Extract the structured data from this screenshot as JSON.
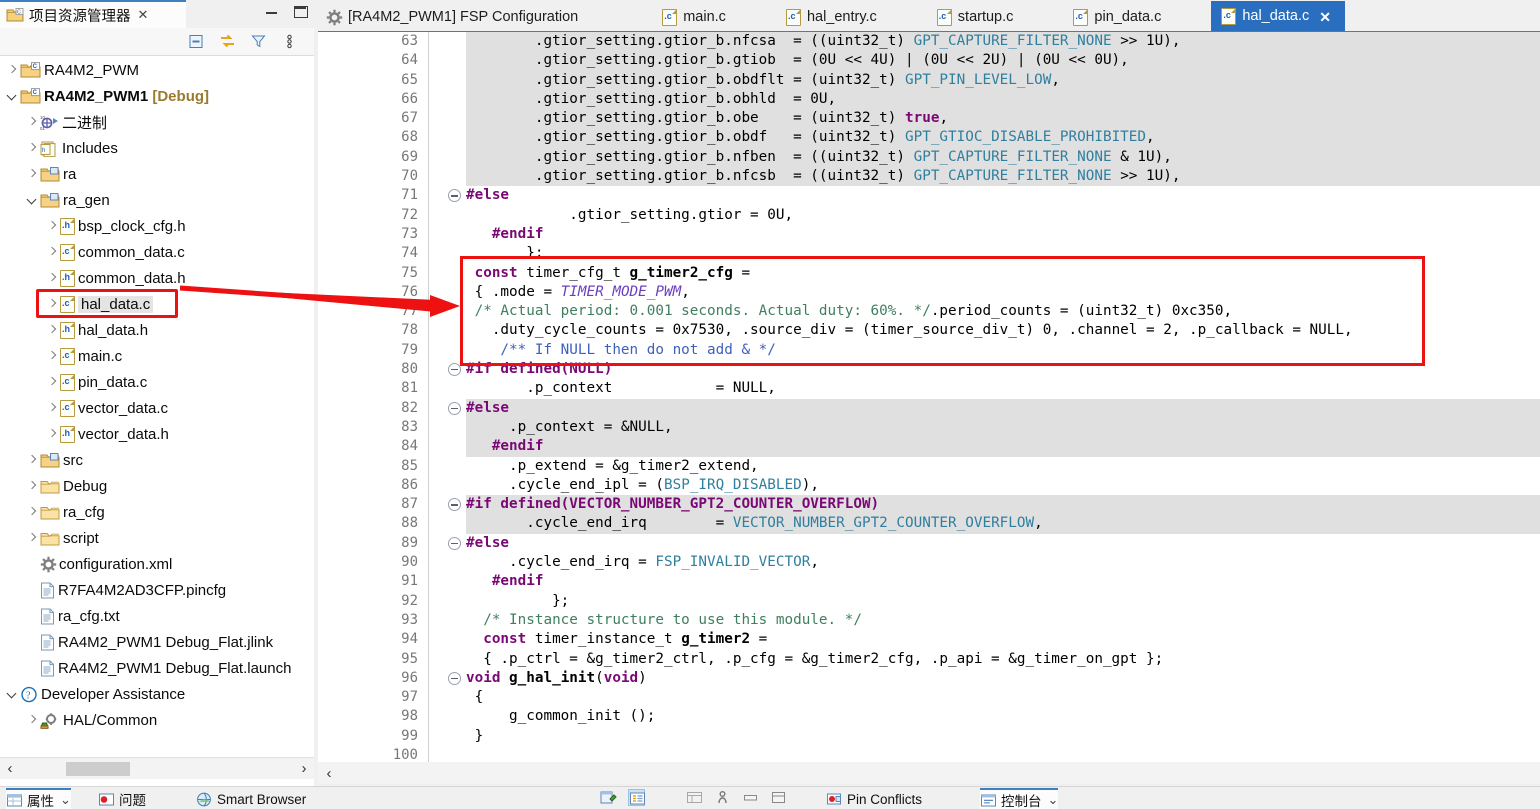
{
  "window": {
    "accent": "#2a6ebf",
    "highlight_red": "#ee1111",
    "row_highlight": "#e0e0e0"
  },
  "editor_tabs": [
    {
      "label": "[RA4M2_PWM1] FSP Configuration",
      "icon": "gear-icon",
      "active": false,
      "closable": false
    },
    {
      "label": "main.c",
      "icon": "c-file-icon",
      "active": false,
      "closable": false
    },
    {
      "label": "hal_entry.c",
      "icon": "c-file-icon",
      "active": false,
      "closable": false
    },
    {
      "label": "startup.c",
      "icon": "c-file-icon",
      "active": false,
      "closable": false
    },
    {
      "label": "pin_data.c",
      "icon": "c-file-icon",
      "active": false,
      "closable": false
    },
    {
      "label": "hal_data.c",
      "icon": "c-file-icon",
      "active": true,
      "closable": true,
      "close_label": "✕"
    }
  ],
  "project_explorer": {
    "title": "项目资源管理器",
    "tab_close_label": "✕",
    "minimize_label": "minimize",
    "maximize_label": "maximize",
    "toolbar_icons": [
      {
        "name": "collapse-all-icon",
        "tooltip": "Collapse All"
      },
      {
        "name": "link-with-editor-icon",
        "tooltip": "Link with Editor"
      },
      {
        "name": "filter-icon",
        "tooltip": "Filters"
      },
      {
        "name": "view-menu-icon",
        "tooltip": "View Menu"
      }
    ],
    "tree": [
      {
        "label": "RA4M2_PWM",
        "indent": 0,
        "state": "closed",
        "icon": "c-project-folder-icon",
        "bold": false
      },
      {
        "label": "RA4M2_PWM1",
        "suffix": "[Debug]",
        "indent": 0,
        "state": "open",
        "icon": "c-project-folder-icon",
        "bold": true
      },
      {
        "label": "二进制",
        "indent": 1,
        "state": "closed",
        "icon": "binaries-icon",
        "bold": false
      },
      {
        "label": "Includes",
        "indent": 1,
        "state": "closed",
        "icon": "includes-icon",
        "bold": false
      },
      {
        "label": "ra",
        "indent": 1,
        "state": "closed",
        "icon": "source-folder-icon",
        "bold": false
      },
      {
        "label": "ra_gen",
        "indent": 1,
        "state": "open",
        "icon": "source-folder-icon",
        "bold": false
      },
      {
        "label": "bsp_clock_cfg.h",
        "indent": 2,
        "state": "closed",
        "icon": "h-file-icon",
        "bold": false
      },
      {
        "label": "common_data.c",
        "indent": 2,
        "state": "closed",
        "icon": "c-file-icon",
        "bold": false
      },
      {
        "label": "common_data.h",
        "indent": 2,
        "state": "closed",
        "icon": "h-file-icon",
        "bold": false
      },
      {
        "label": "hal_data.c",
        "indent": 2,
        "state": "closed",
        "icon": "c-file-icon",
        "bold": false,
        "selected": true
      },
      {
        "label": "hal_data.h",
        "indent": 2,
        "state": "closed",
        "icon": "h-file-icon",
        "bold": false
      },
      {
        "label": "main.c",
        "indent": 2,
        "state": "closed",
        "icon": "c-file-icon",
        "bold": false
      },
      {
        "label": "pin_data.c",
        "indent": 2,
        "state": "closed",
        "icon": "c-file-icon",
        "bold": false
      },
      {
        "label": "vector_data.c",
        "indent": 2,
        "state": "closed",
        "icon": "c-file-icon",
        "bold": false
      },
      {
        "label": "vector_data.h",
        "indent": 2,
        "state": "closed",
        "icon": "h-file-icon",
        "bold": false
      },
      {
        "label": "src",
        "indent": 1,
        "state": "closed",
        "icon": "source-folder-icon",
        "bold": false
      },
      {
        "label": "Debug",
        "indent": 1,
        "state": "closed",
        "icon": "folder-icon",
        "bold": false
      },
      {
        "label": "ra_cfg",
        "indent": 1,
        "state": "closed",
        "icon": "folder-icon",
        "bold": false
      },
      {
        "label": "script",
        "indent": 1,
        "state": "closed",
        "icon": "folder-icon",
        "bold": false
      },
      {
        "label": "configuration.xml",
        "indent": 1,
        "state": "none",
        "icon": "gear-icon",
        "bold": false
      },
      {
        "label": "R7FA4M2AD3CFP.pincfg",
        "indent": 1,
        "state": "none",
        "icon": "document-icon",
        "bold": false
      },
      {
        "label": "ra_cfg.txt",
        "indent": 1,
        "state": "none",
        "icon": "document-icon",
        "bold": false
      },
      {
        "label": "RA4M2_PWM1 Debug_Flat.jlink",
        "indent": 1,
        "state": "none",
        "icon": "document-icon",
        "bold": false
      },
      {
        "label": "RA4M2_PWM1 Debug_Flat.launch",
        "indent": 1,
        "state": "none",
        "icon": "document-icon",
        "bold": false
      },
      {
        "label": "Developer Assistance",
        "indent": 0,
        "state": "open",
        "icon": "help-icon",
        "bold": false
      },
      {
        "label": "HAL/Common",
        "indent": 1,
        "state": "closed",
        "icon": "hal-module-icon",
        "bold": false
      }
    ],
    "hscroll": {
      "left_arrow": "‹",
      "right_arrow": "›"
    }
  },
  "code": {
    "first_line": 63,
    "last_line": 100,
    "hscroll_left_arrow": "‹",
    "lines": [
      {
        "n": 63,
        "hl": true,
        "fold": false,
        "segs": [
          [
            "",
            "        .gtior_setting.gtior_b.nfcsa  = (("
          ],
          [
            "ty",
            "uint32_t"
          ],
          [
            "",
            ") "
          ],
          [
            "mac",
            "GPT_CAPTURE_FILTER_NONE"
          ],
          [
            "",
            " >> 1U),"
          ]
        ]
      },
      {
        "n": 64,
        "hl": true,
        "fold": false,
        "segs": [
          [
            "",
            "        .gtior_setting.gtior_b.gtiob  = (0U << 4U) | (0U << 2U) | (0U << 0U),"
          ]
        ]
      },
      {
        "n": 65,
        "hl": true,
        "fold": false,
        "segs": [
          [
            "",
            "        .gtior_setting.gtior_b.obdflt = ("
          ],
          [
            "ty",
            "uint32_t"
          ],
          [
            "",
            ") "
          ],
          [
            "mac",
            "GPT_PIN_LEVEL_LOW"
          ],
          [
            "",
            ","
          ]
        ]
      },
      {
        "n": 66,
        "hl": true,
        "fold": false,
        "segs": [
          [
            "",
            "        .gtior_setting.gtior_b.obhld  = 0U,"
          ]
        ]
      },
      {
        "n": 67,
        "hl": true,
        "fold": false,
        "segs": [
          [
            "",
            "        .gtior_setting.gtior_b.obe    = ("
          ],
          [
            "ty",
            "uint32_t"
          ],
          [
            "",
            ") "
          ],
          [
            "k",
            "true"
          ],
          [
            "",
            ","
          ]
        ]
      },
      {
        "n": 68,
        "hl": true,
        "fold": false,
        "segs": [
          [
            "",
            "        .gtior_setting.gtior_b.obdf   = ("
          ],
          [
            "ty",
            "uint32_t"
          ],
          [
            "",
            ") "
          ],
          [
            "mac",
            "GPT_GTIOC_DISABLE_PROHIBITED"
          ],
          [
            "",
            ","
          ]
        ]
      },
      {
        "n": 69,
        "hl": true,
        "fold": false,
        "segs": [
          [
            "",
            "        .gtior_setting.gtior_b.nfben  = (("
          ],
          [
            "ty",
            "uint32_t"
          ],
          [
            "",
            ") "
          ],
          [
            "mac",
            "GPT_CAPTURE_FILTER_NONE"
          ],
          [
            "",
            " & 1U),"
          ]
        ]
      },
      {
        "n": 70,
        "hl": true,
        "fold": false,
        "segs": [
          [
            "",
            "        .gtior_setting.gtior_b.nfcsb  = (("
          ],
          [
            "ty",
            "uint32_t"
          ],
          [
            "",
            ") "
          ],
          [
            "mac",
            "GPT_CAPTURE_FILTER_NONE"
          ],
          [
            "",
            " >> 1U),"
          ]
        ]
      },
      {
        "n": 71,
        "hl": false,
        "fold": true,
        "segs": [
          [
            "pp",
            "#else"
          ]
        ]
      },
      {
        "n": 72,
        "hl": false,
        "fold": false,
        "segs": [
          [
            "",
            "            .gtior_setting.gtior = 0U,"
          ]
        ]
      },
      {
        "n": 73,
        "hl": false,
        "fold": false,
        "segs": [
          [
            "pp",
            "   #endif"
          ]
        ]
      },
      {
        "n": 74,
        "hl": false,
        "fold": false,
        "segs": [
          [
            "",
            "       };"
          ]
        ]
      },
      {
        "n": 75,
        "hl": false,
        "fold": false,
        "segs": [
          [
            "k",
            " const "
          ],
          [
            "ty",
            "timer_cfg_t"
          ],
          [
            "fn",
            " g_timer2_cfg"
          ],
          [
            "",
            " ="
          ]
        ]
      },
      {
        "n": 76,
        "hl": false,
        "fold": false,
        "segs": [
          [
            "",
            " { .mode = "
          ],
          [
            "ital",
            "TIMER_MODE_PWM"
          ],
          [
            "",
            ","
          ]
        ]
      },
      {
        "n": 77,
        "hl": false,
        "fold": false,
        "segs": [
          [
            "cm",
            " /* Actual period: 0.001 seconds. Actual duty: 60%. */"
          ],
          [
            "",
            ".period_counts = ("
          ],
          [
            "ty",
            "uint32_t"
          ],
          [
            "",
            ") 0xc350,"
          ]
        ]
      },
      {
        "n": 78,
        "hl": false,
        "fold": false,
        "segs": [
          [
            "",
            "   .duty_cycle_counts = 0x7530, .source_div = ("
          ],
          [
            "ty",
            "timer_source_div_t"
          ],
          [
            "",
            ") 0, .channel = 2, .p_callback = NULL,"
          ]
        ]
      },
      {
        "n": 79,
        "hl": false,
        "fold": false,
        "segs": [
          [
            "cmb",
            "    /** If NULL then do not add & */"
          ]
        ]
      },
      {
        "n": 80,
        "hl": false,
        "fold": true,
        "segs": [
          [
            "pp",
            "#if defined(NULL)"
          ]
        ]
      },
      {
        "n": 81,
        "hl": false,
        "fold": false,
        "segs": [
          [
            "",
            "       .p_context            = NULL,"
          ]
        ]
      },
      {
        "n": 82,
        "hl": true,
        "fold": true,
        "segs": [
          [
            "pp",
            "#else"
          ]
        ]
      },
      {
        "n": 83,
        "hl": true,
        "fold": false,
        "segs": [
          [
            "",
            "     .p_context = &NULL,"
          ]
        ]
      },
      {
        "n": 84,
        "hl": true,
        "fold": false,
        "segs": [
          [
            "pp",
            "   #endif"
          ]
        ]
      },
      {
        "n": 85,
        "hl": false,
        "fold": false,
        "segs": [
          [
            "",
            "     .p_extend = &g_timer2_extend,"
          ]
        ]
      },
      {
        "n": 86,
        "hl": false,
        "fold": false,
        "segs": [
          [
            "",
            "     .cycle_end_ipl = ("
          ],
          [
            "mac",
            "BSP_IRQ_DISABLED"
          ],
          [
            "",
            "),"
          ]
        ]
      },
      {
        "n": 87,
        "hl": true,
        "fold": true,
        "segs": [
          [
            "pp",
            "#if defined(VECTOR_NUMBER_GPT2_COUNTER_OVERFLOW)"
          ]
        ]
      },
      {
        "n": 88,
        "hl": true,
        "fold": false,
        "segs": [
          [
            "",
            "       .cycle_end_irq        = "
          ],
          [
            "mac",
            "VECTOR_NUMBER_GPT2_COUNTER_OVERFLOW"
          ],
          [
            "",
            ","
          ]
        ]
      },
      {
        "n": 89,
        "hl": false,
        "fold": true,
        "segs": [
          [
            "pp",
            "#else"
          ]
        ]
      },
      {
        "n": 90,
        "hl": false,
        "fold": false,
        "segs": [
          [
            "",
            "     .cycle_end_irq = "
          ],
          [
            "mac",
            "FSP_INVALID_VECTOR"
          ],
          [
            "",
            ","
          ]
        ]
      },
      {
        "n": 91,
        "hl": false,
        "fold": false,
        "segs": [
          [
            "pp",
            "   #endif"
          ]
        ]
      },
      {
        "n": 92,
        "hl": false,
        "fold": false,
        "segs": [
          [
            "",
            "          };"
          ]
        ]
      },
      {
        "n": 93,
        "hl": false,
        "fold": false,
        "segs": [
          [
            "cm",
            "  /* Instance structure to use this module. */"
          ]
        ]
      },
      {
        "n": 94,
        "hl": false,
        "fold": false,
        "segs": [
          [
            "k",
            "  const "
          ],
          [
            "ty",
            "timer_instance_t"
          ],
          [
            "fn",
            " g_timer2"
          ],
          [
            "",
            " ="
          ]
        ]
      },
      {
        "n": 95,
        "hl": false,
        "fold": false,
        "segs": [
          [
            "",
            "  { .p_ctrl = &g_timer2_ctrl, .p_cfg = &g_timer2_cfg, .p_api = &g_timer_on_gpt };"
          ]
        ]
      },
      {
        "n": 96,
        "hl": false,
        "fold": true,
        "segs": [
          [
            "k",
            "void"
          ],
          [
            "fn",
            " g_hal_init"
          ],
          [
            "",
            "("
          ],
          [
            "k",
            "void"
          ],
          [
            "",
            ")"
          ]
        ]
      },
      {
        "n": 97,
        "hl": false,
        "fold": false,
        "segs": [
          [
            "",
            " {"
          ]
        ]
      },
      {
        "n": 98,
        "hl": false,
        "fold": false,
        "segs": [
          [
            "",
            "     g_common_init ();"
          ]
        ]
      },
      {
        "n": 99,
        "hl": false,
        "fold": false,
        "segs": [
          [
            "",
            " }"
          ]
        ]
      },
      {
        "n": 100,
        "hl": false,
        "fold": false,
        "segs": [
          [
            "",
            ""
          ]
        ]
      }
    ]
  },
  "annotations": {
    "tree_box_target": "hal_data.c",
    "code_box_target": "g_timer2_cfg definition",
    "arrow_color": "#ee1111"
  },
  "bottom_bar": {
    "tabs": [
      {
        "label": "属性",
        "icon": "properties-icon",
        "selected": true,
        "pin": "⌄"
      },
      {
        "label": "问题",
        "icon": "problems-icon",
        "selected": false
      },
      {
        "label": "Smart Browser",
        "icon": "smart-browser-icon",
        "selected": false
      },
      {
        "label": "Pin Conflicts",
        "icon": "pin-conflicts-icon",
        "selected": false
      },
      {
        "label": "控制台",
        "icon": "console-icon",
        "selected": true,
        "pin": "⌄"
      }
    ],
    "tool_icons": [
      {
        "name": "new-pin-config-icon",
        "active": false
      },
      {
        "name": "tree-view-icon",
        "active": true
      },
      {
        "name": "filter-icon",
        "active": false
      },
      {
        "name": "table-view-icon",
        "active": false
      },
      {
        "name": "person-icon",
        "active": false
      },
      {
        "name": "horizontal-layout-icon",
        "active": false
      },
      {
        "name": "vertical-layout-icon",
        "active": false
      }
    ]
  }
}
